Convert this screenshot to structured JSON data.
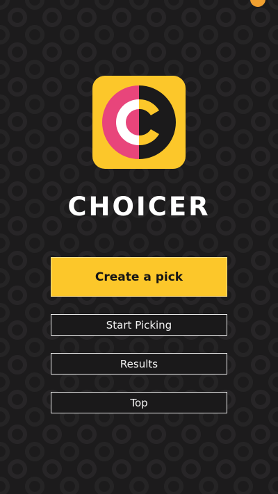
{
  "app": {
    "name": "CHOICER"
  },
  "menu": {
    "create_label": "Create a pick",
    "start_label": "Start Picking",
    "results_label": "Results",
    "top_label": "Top"
  },
  "colors": {
    "background": "#1c1b1c",
    "accent_yellow": "#fcc72a",
    "accent_pink": "#e8457b",
    "text_light": "#ffffff"
  }
}
